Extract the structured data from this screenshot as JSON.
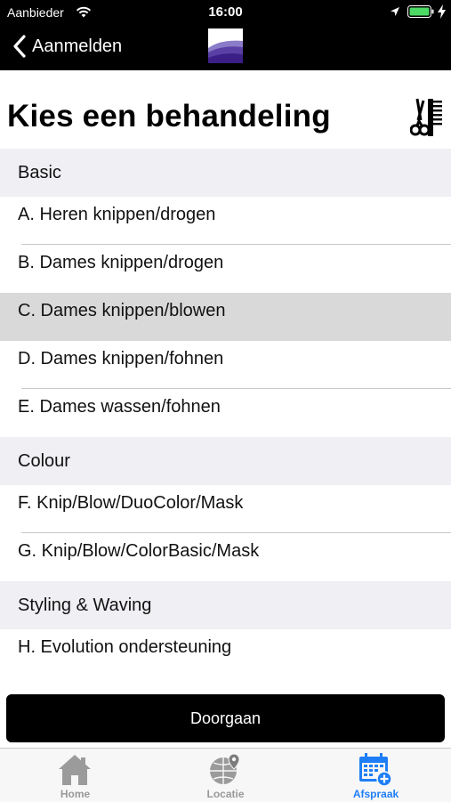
{
  "status_bar": {
    "carrier": "Aanbieder",
    "time": "16:00"
  },
  "nav": {
    "back_label": "Aanmelden"
  },
  "page": {
    "title": "Kies een behandeling"
  },
  "sections": [
    {
      "header": "Basic",
      "items": [
        "A. Heren knippen/drogen",
        "B. Dames knippen/drogen",
        "C. Dames knippen/blowen",
        "D. Dames knippen/fohnen",
        "E. Dames wassen/fohnen"
      ]
    },
    {
      "header": "Colour",
      "items": [
        "F. Knip/Blow/DuoColor/Mask",
        "G. Knip/Blow/ColorBasic/Mask"
      ]
    },
    {
      "header": "Styling & Waving",
      "items": [
        "H. Evolution ondersteuning"
      ]
    }
  ],
  "selected_item": "C. Dames knippen/blowen",
  "continue_button": "Doorgaan",
  "tabs": [
    {
      "label": "Home",
      "icon": "home-icon"
    },
    {
      "label": "Locatie",
      "icon": "globe-location-icon"
    },
    {
      "label": "Afspraak",
      "icon": "calendar-add-icon",
      "active": true
    }
  ],
  "colors": {
    "accent": "#1e7ef7",
    "nav_background": "#000000",
    "selected_row": "#d9d9d9",
    "section_background": "#efeff4"
  }
}
